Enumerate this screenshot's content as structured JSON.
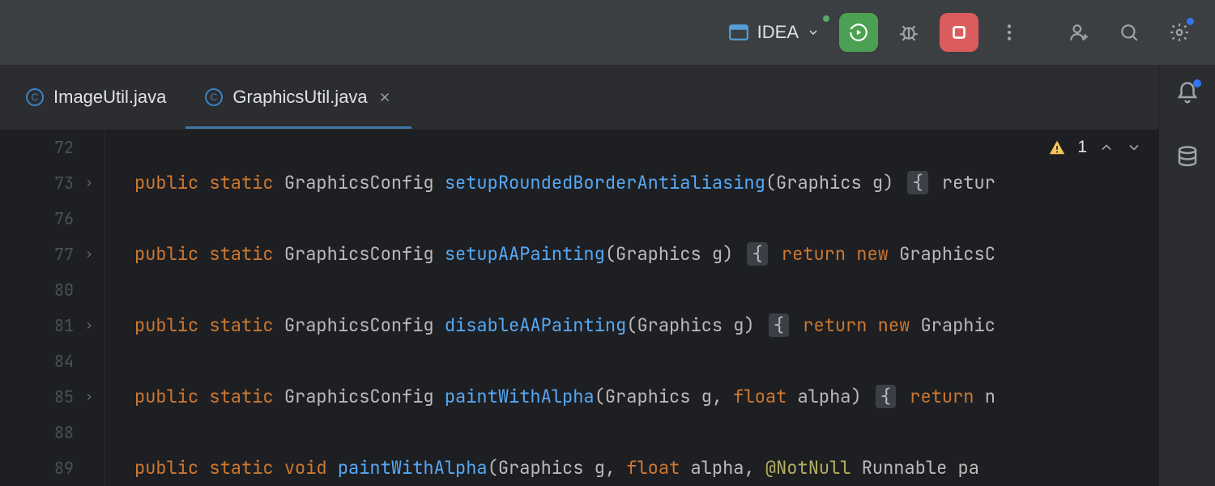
{
  "toolbar": {
    "run_config_label": "IDEA"
  },
  "tabs": [
    {
      "label": "ImageUtil.java",
      "active": false
    },
    {
      "label": "GraphicsUtil.java",
      "active": true
    }
  ],
  "inspections": {
    "warning_count": "1"
  },
  "editor": {
    "lines": [
      {
        "n": "72",
        "foldable": false,
        "tokens": []
      },
      {
        "n": "73",
        "foldable": true,
        "tokens": [
          {
            "t": "kw",
            "v": "public "
          },
          {
            "t": "kw",
            "v": "static "
          },
          {
            "t": "type",
            "v": "GraphicsConfig "
          },
          {
            "t": "method",
            "v": "setupRoundedBorderAntialiasing"
          },
          {
            "t": "paren",
            "v": "("
          },
          {
            "t": "type",
            "v": "Graphics "
          },
          {
            "t": "param-name",
            "v": "g"
          },
          {
            "t": "paren",
            "v": ") "
          },
          {
            "t": "fold-brace",
            "v": "{"
          },
          {
            "t": "after-fold",
            "v": " retur"
          }
        ]
      },
      {
        "n": "76",
        "foldable": false,
        "tokens": []
      },
      {
        "n": "77",
        "foldable": true,
        "tokens": [
          {
            "t": "kw",
            "v": "public "
          },
          {
            "t": "kw",
            "v": "static "
          },
          {
            "t": "type",
            "v": "GraphicsConfig "
          },
          {
            "t": "method",
            "v": "setupAAPainting"
          },
          {
            "t": "paren",
            "v": "("
          },
          {
            "t": "type",
            "v": "Graphics "
          },
          {
            "t": "param-name",
            "v": "g"
          },
          {
            "t": "paren",
            "v": ") "
          },
          {
            "t": "fold-brace",
            "v": "{"
          },
          {
            "t": "after-fold",
            "v": " "
          },
          {
            "t": "kw",
            "v": "return "
          },
          {
            "t": "kw",
            "v": "new "
          },
          {
            "t": "type",
            "v": "GraphicsC"
          }
        ]
      },
      {
        "n": "80",
        "foldable": false,
        "tokens": []
      },
      {
        "n": "81",
        "foldable": true,
        "tokens": [
          {
            "t": "kw",
            "v": "public "
          },
          {
            "t": "kw",
            "v": "static "
          },
          {
            "t": "type",
            "v": "GraphicsConfig "
          },
          {
            "t": "method",
            "v": "disableAAPainting"
          },
          {
            "t": "paren",
            "v": "("
          },
          {
            "t": "type",
            "v": "Graphics "
          },
          {
            "t": "param-name",
            "v": "g"
          },
          {
            "t": "paren",
            "v": ") "
          },
          {
            "t": "fold-brace",
            "v": "{"
          },
          {
            "t": "after-fold",
            "v": " "
          },
          {
            "t": "kw",
            "v": "return "
          },
          {
            "t": "kw",
            "v": "new "
          },
          {
            "t": "type",
            "v": "Graphic"
          }
        ]
      },
      {
        "n": "84",
        "foldable": false,
        "tokens": []
      },
      {
        "n": "85",
        "foldable": true,
        "tokens": [
          {
            "t": "kw",
            "v": "public "
          },
          {
            "t": "kw",
            "v": "static "
          },
          {
            "t": "type",
            "v": "GraphicsConfig "
          },
          {
            "t": "method",
            "v": "paintWithAlpha"
          },
          {
            "t": "paren",
            "v": "("
          },
          {
            "t": "type",
            "v": "Graphics "
          },
          {
            "t": "param-name",
            "v": "g"
          },
          {
            "t": "paren",
            "v": ", "
          },
          {
            "t": "float-kw",
            "v": "float "
          },
          {
            "t": "param-name",
            "v": "alpha"
          },
          {
            "t": "paren",
            "v": ") "
          },
          {
            "t": "fold-brace",
            "v": "{"
          },
          {
            "t": "after-fold",
            "v": " "
          },
          {
            "t": "kw",
            "v": "return "
          },
          {
            "t": "type",
            "v": "n"
          }
        ]
      },
      {
        "n": "88",
        "foldable": false,
        "tokens": []
      },
      {
        "n": "89",
        "foldable": false,
        "tokens": [
          {
            "t": "kw",
            "v": "public "
          },
          {
            "t": "kw",
            "v": "static "
          },
          {
            "t": "kw",
            "v": "void "
          },
          {
            "t": "method",
            "v": "paintWithAlpha"
          },
          {
            "t": "paren",
            "v": "("
          },
          {
            "t": "type",
            "v": "Graphics "
          },
          {
            "t": "param-name",
            "v": "g"
          },
          {
            "t": "paren",
            "v": ", "
          },
          {
            "t": "float-kw",
            "v": "float "
          },
          {
            "t": "param-name",
            "v": "alpha"
          },
          {
            "t": "paren",
            "v": ", "
          },
          {
            "t": "annotation",
            "v": "@NotNull "
          },
          {
            "t": "type",
            "v": "Runnable "
          },
          {
            "t": "param-name",
            "v": "pa"
          }
        ]
      }
    ]
  }
}
